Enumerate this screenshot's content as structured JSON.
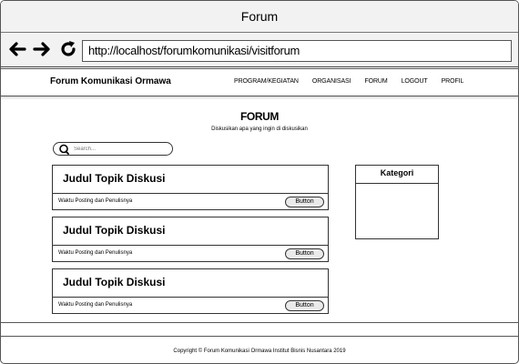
{
  "window": {
    "title": "Forum"
  },
  "browser": {
    "url": "http://localhost/forumkomunikasi/visitforum"
  },
  "header": {
    "brand": "Forum Komunikasi Ormawa",
    "menu": [
      "PROGRAM/KEGIATAN",
      "ORGANISASI",
      "FORUM",
      "LOGOUT",
      "PROFIL"
    ]
  },
  "hero": {
    "title": "FORUM",
    "subtitle": "Diskusikan apa yang ingin di diskusikan"
  },
  "search": {
    "placeholder": "Search..."
  },
  "topics": [
    {
      "title": "Judul Topik Diskusi",
      "meta": "Waktu Posting dan Penulisnya",
      "button": "Button"
    },
    {
      "title": "Judul Topik Diskusi",
      "meta": "Waktu Posting dan Penulisnya",
      "button": "Button"
    },
    {
      "title": "Judul Topik Diskusi",
      "meta": "Waktu Posting dan Penulisnya",
      "button": "Button"
    }
  ],
  "category": {
    "title": "Kategori"
  },
  "footer": {
    "copyright": "Copyright © Forum Komunikasi Ormawa Institut Bisnis Nusantara 2019"
  },
  "icons": {
    "back": "arrow-left-icon",
    "forward": "arrow-right-icon",
    "reload": "reload-icon",
    "search": "magnifier-icon"
  }
}
